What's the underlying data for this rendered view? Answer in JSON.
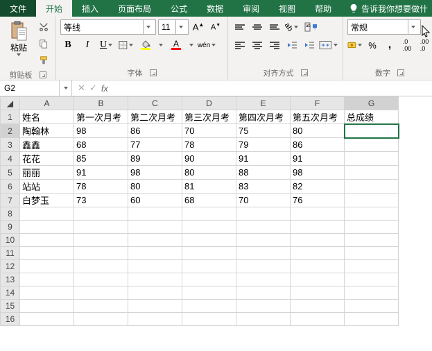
{
  "tabs": {
    "file": "文件",
    "home": "开始",
    "insert": "插入",
    "layout": "页面布局",
    "formula": "公式",
    "data": "数据",
    "review": "审阅",
    "view": "视图",
    "help": "帮助"
  },
  "tellme": "告诉我你想要做什",
  "ribbon": {
    "clipboard": {
      "paste": "粘贴",
      "label": "剪贴板"
    },
    "font": {
      "name": "等线",
      "size": "11",
      "label": "字体",
      "wen": "wén"
    },
    "align": {
      "label": "对齐方式"
    },
    "number": {
      "format": "常规",
      "label": "数字"
    }
  },
  "namebox": "G2",
  "sheet": {
    "cols": [
      "A",
      "B",
      "C",
      "D",
      "E",
      "F",
      "G"
    ],
    "rows": 16,
    "header_row": [
      "姓名",
      "第一次月考",
      "第二次月考",
      "第三次月考",
      "第四次月考",
      "第五次月考",
      "总成绩"
    ],
    "data": [
      [
        "陶翰林",
        "98",
        "86",
        "70",
        "75",
        "80",
        ""
      ],
      [
        "鑫鑫",
        "68",
        "77",
        "78",
        "79",
        "86",
        ""
      ],
      [
        "花花",
        "85",
        "89",
        "90",
        "91",
        "91",
        ""
      ],
      [
        "丽丽",
        "91",
        "98",
        "80",
        "88",
        "98",
        ""
      ],
      [
        "站站",
        "78",
        "80",
        "81",
        "83",
        "82",
        ""
      ],
      [
        "白梦玉",
        "73",
        "60",
        "68",
        "70",
        "76",
        ""
      ]
    ],
    "selected": {
      "row": 2,
      "col": 7
    }
  },
  "chart_data": {
    "type": "table",
    "title": "",
    "columns": [
      "姓名",
      "第一次月考",
      "第二次月考",
      "第三次月考",
      "第四次月考",
      "第五次月考",
      "总成绩"
    ],
    "rows": [
      {
        "姓名": "陶翰林",
        "第一次月考": 98,
        "第二次月考": 86,
        "第三次月考": 70,
        "第四次月考": 75,
        "第五次月考": 80,
        "总成绩": null
      },
      {
        "姓名": "鑫鑫",
        "第一次月考": 68,
        "第二次月考": 77,
        "第三次月考": 78,
        "第四次月考": 79,
        "第五次月考": 86,
        "总成绩": null
      },
      {
        "姓名": "花花",
        "第一次月考": 85,
        "第二次月考": 89,
        "第三次月考": 90,
        "第四次月考": 91,
        "第五次月考": 91,
        "总成绩": null
      },
      {
        "姓名": "丽丽",
        "第一次月考": 91,
        "第二次月考": 98,
        "第三次月考": 80,
        "第四次月考": 88,
        "第五次月考": 98,
        "总成绩": null
      },
      {
        "姓名": "站站",
        "第一次月考": 78,
        "第二次月考": 80,
        "第三次月考": 81,
        "第四次月考": 83,
        "第五次月考": 82,
        "总成绩": null
      },
      {
        "姓名": "白梦玉",
        "第一次月考": 73,
        "第二次月考": 60,
        "第三次月考": 68,
        "第四次月考": 70,
        "第五次月考": 76,
        "总成绩": null
      }
    ]
  }
}
